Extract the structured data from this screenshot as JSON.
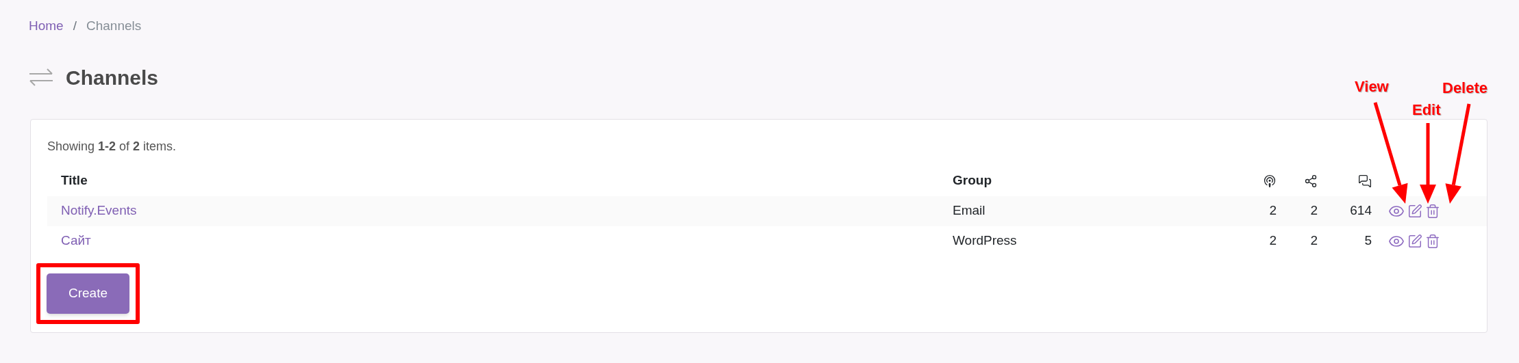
{
  "breadcrumb": [
    {
      "label": "Home",
      "kind": "link"
    },
    {
      "label": "/",
      "kind": "separator"
    },
    {
      "label": "Channels",
      "kind": "current"
    }
  ],
  "page_title": "Channels",
  "summary": "Showing **1-2** of **2** items.",
  "table": {
    "columns": [
      {
        "kind": "text",
        "label": "Title"
      },
      {
        "kind": "text",
        "label": "Group"
      },
      {
        "kind": "icon"
      },
      {
        "kind": "icon"
      },
      {
        "kind": "icon"
      },
      {
        "kind": "actions"
      }
    ],
    "rows": [
      {
        "title": "Notify.Events",
        "group": "Email",
        "values": [
          "2",
          "2",
          "614"
        ]
      },
      {
        "title": "Сайт",
        "group": "WordPress",
        "values": [
          "2",
          "2",
          "5"
        ]
      }
    ]
  },
  "create_button": {
    "label": "Create",
    "highlighted": true
  },
  "annotations": [
    {
      "label": "View"
    },
    {
      "label": "Edit"
    },
    {
      "label": "Delete"
    }
  ]
}
